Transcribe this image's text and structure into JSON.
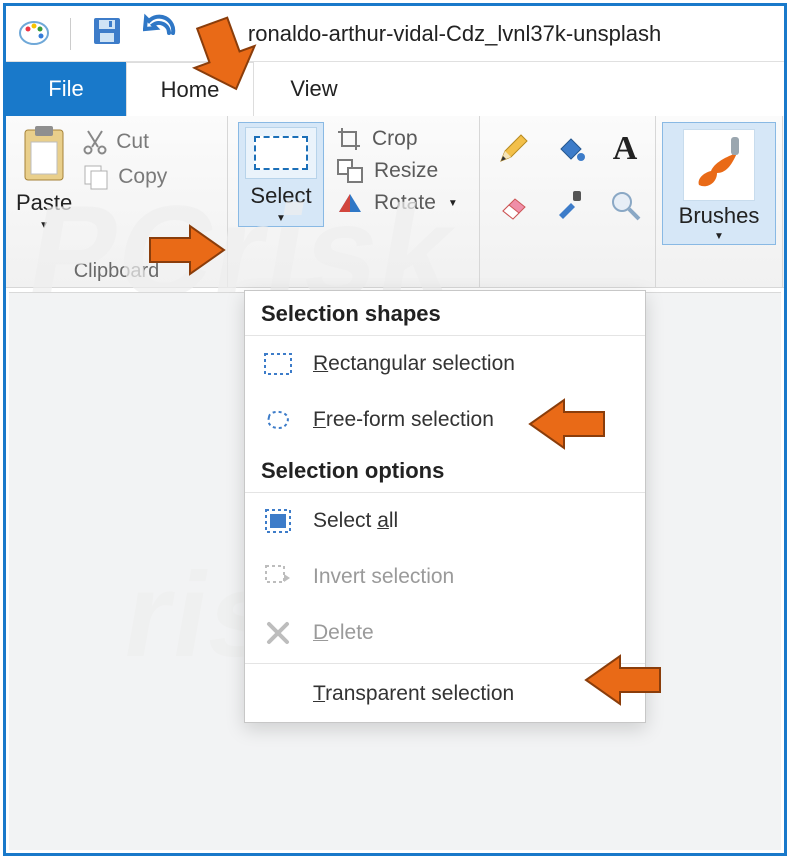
{
  "titlebar": {
    "filename": "ronaldo-arthur-vidal-Cdz_lvnl37k-unsplash"
  },
  "tabs": {
    "file": "File",
    "home": "Home",
    "view": "View"
  },
  "clipboard": {
    "group_label": "Clipboard",
    "paste": "Paste",
    "cut": "Cut",
    "copy": "Copy"
  },
  "image_group": {
    "select": "Select",
    "crop": "Crop",
    "resize": "Resize",
    "rotate": "Rotate"
  },
  "tools": {
    "pencil": "pencil-icon",
    "fill": "fill-icon",
    "text": "text-icon",
    "eraser": "eraser-icon",
    "picker": "color-picker-icon",
    "magnifier": "magnifier-icon"
  },
  "brushes": {
    "label": "Brushes"
  },
  "select_menu": {
    "shapes_header": "Selection shapes",
    "rectangular": "Rectangular selection",
    "freeform": "Free-form selection",
    "options_header": "Selection options",
    "select_all": "Select all",
    "invert": "Invert selection",
    "delete": "Delete",
    "transparent": "Transparent selection",
    "underline": {
      "r": "R",
      "f": "F",
      "a": "a",
      "d": "D",
      "t": "T"
    }
  },
  "watermark": "PCrisk.com"
}
